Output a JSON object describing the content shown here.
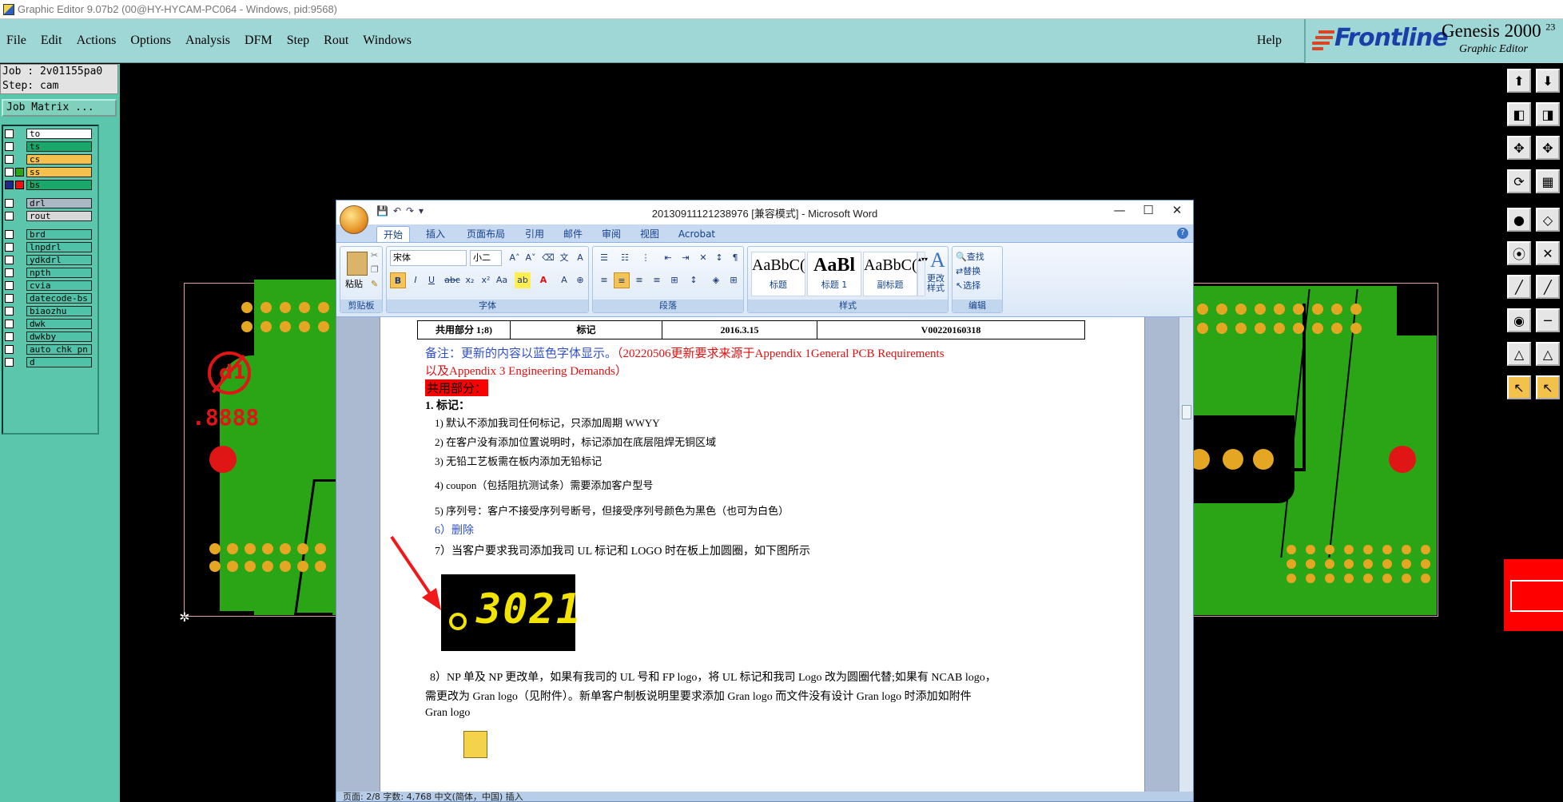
{
  "titlebar": {
    "text": "Graphic Editor 9.07b2 (00@HY-HYCAM-PC064 - Windows, pid:9568)"
  },
  "menubar": {
    "items": [
      "File",
      "Edit",
      "Actions",
      "Options",
      "Analysis",
      "DFM",
      "Step",
      "Rout",
      "Windows"
    ],
    "help": "Help"
  },
  "brand": {
    "logo": "Frontline",
    "product": "Genesis 2000",
    "version_sup": "23",
    "subtitle": "Graphic Editor"
  },
  "job": {
    "job_line": "Job : 2v01155pa0",
    "step_line": "Step: cam",
    "matrix_button": "Job Matrix ..."
  },
  "layers": [
    {
      "name": "to",
      "color": "#ffffff",
      "sel": ""
    },
    {
      "name": "ts",
      "color": "#1aa86a",
      "sel": ""
    },
    {
      "name": "cs",
      "color": "#f6c04c",
      "sel": ""
    },
    {
      "name": "ss",
      "color": "#f6c04c",
      "sel": "#2aa515"
    },
    {
      "name": "bs",
      "color": "#1aa86a",
      "sel": "#f01010"
    },
    {
      "name": "drl",
      "color": "#a9b8c4",
      "sel": ""
    },
    {
      "name": "rout",
      "color": "#d8d8d8",
      "sel": ""
    },
    {
      "name": "brd",
      "color": "#4fc2a8",
      "sel": ""
    },
    {
      "name": "lnpdrl",
      "color": "#4fc2a8",
      "sel": ""
    },
    {
      "name": "ydkdrl",
      "color": "#4fc2a8",
      "sel": ""
    },
    {
      "name": "npth",
      "color": "#4fc2a8",
      "sel": ""
    },
    {
      "name": "cvia",
      "color": "#4fc2a8",
      "sel": ""
    },
    {
      "name": "datecode-bs",
      "color": "#4fc2a8",
      "sel": ""
    },
    {
      "name": "biaozhu",
      "color": "#4fc2a8",
      "sel": ""
    },
    {
      "name": "dwk",
      "color": "#4fc2a8",
      "sel": ""
    },
    {
      "name": "dwkby",
      "color": "#4fc2a8",
      "sel": ""
    },
    {
      "name": "auto_chk_pn",
      "color": "#4fc2a8",
      "sel": ""
    },
    {
      "name": "d",
      "color": "#4fc2a8",
      "sel": ""
    }
  ],
  "pcb": {
    "red_digits": ".8888",
    "marker": "d1"
  },
  "word": {
    "title": "20130911121238976 [兼容模式] - Microsoft Word",
    "controls": {
      "min": "—",
      "max": "☐",
      "close": "✕"
    },
    "tabs": [
      "开始",
      "插入",
      "页面布局",
      "引用",
      "邮件",
      "审阅",
      "视图",
      "Acrobat"
    ],
    "ribbon": {
      "clipboard": {
        "paste": "粘贴",
        "label": "剪贴板"
      },
      "font": {
        "face": "宋体",
        "size": "小二",
        "label": "字体"
      },
      "paragraph": {
        "label": "段落"
      },
      "styles": {
        "items": [
          {
            "preview": "AaBbC(",
            "caption": "标题"
          },
          {
            "preview": "AaBl",
            "caption": "标题 1"
          },
          {
            "preview": "AaBbC(",
            "caption": "副标题"
          }
        ],
        "change": "更改样式",
        "label": "样式"
      },
      "editing": {
        "find": "查找",
        "replace": "替换",
        "select": "选择",
        "label": "编辑"
      }
    },
    "doc": {
      "table_cells": [
        "共用部分 1;8)",
        "标记",
        "2016.3.15",
        "V00220160318"
      ],
      "note_blue": "备注：更新的内容以蓝色字体显示。",
      "note_red_1": "（20220506更新要求来源于Appendix 1General PCB Requirements",
      "note_red_2": "以及Appendix 3 Engineering Demands）",
      "section": "共用部分：",
      "heading": "1.   标记：",
      "items": [
        "1)  默认不添加我司任何标记，只添加周期 WWYY",
        "2)  在客户没有添加位置说明时，标记添加在底层阻焊无铜区域",
        "3)  无铅工艺板需在板内添加无铅标记",
        "4)  coupon（包括阻抗测试条）需要添加客户型号",
        "5)  序列号：客户不接受序列号断号，但接受序列号颜色为黑色（也可为白色）"
      ],
      "item6": "6）删除",
      "item7": "7）当客户要求我司添加我司 UL 标记和 LOGO 时在板上加圆圈，如下图所示",
      "sample_digits": "3021",
      "item8_1": "8）NP 单及 NP 更改单，如果有我司的 UL 号和 FP logo，将 UL 标记和我司 Logo 改为圆圈代替;如果有 NCAB logo，",
      "item8_2": "需更改为 Gran logo（见附件）。新单客户制板说明里要求添加 Gran logo 而文件没有设计 Gran logo 时添加如附件",
      "item8_3": "Gran logo"
    },
    "status": "页面: 2/8    字数: 4,768    中文(简体，中国)    插入"
  }
}
